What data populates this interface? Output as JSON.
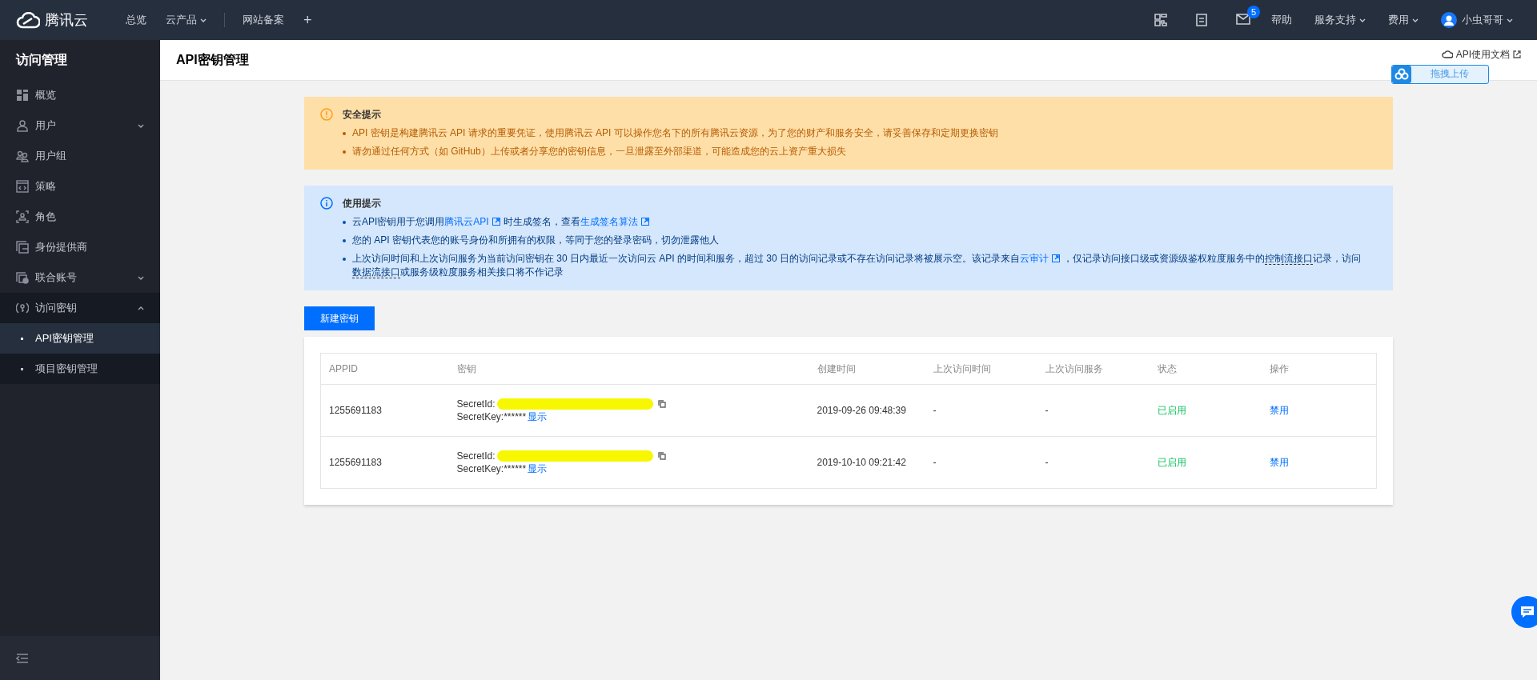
{
  "topbar": {
    "logo": "腾讯云",
    "nav": [
      {
        "label": "总览",
        "dropdown": false
      },
      {
        "label": "云产品",
        "dropdown": true
      },
      {
        "label": "网站备案",
        "dropdown": false
      }
    ],
    "plus": "+",
    "mail_badge": "5",
    "right": [
      {
        "label": "帮助",
        "dropdown": false
      },
      {
        "label": "服务支持",
        "dropdown": true
      },
      {
        "label": "费用",
        "dropdown": true
      }
    ],
    "user": "小虫哥哥"
  },
  "sidebar": {
    "title": "访问管理",
    "items": [
      {
        "label": "概览",
        "kind": "link",
        "selected": false
      },
      {
        "label": "用户",
        "kind": "group",
        "expanded": false,
        "selected": false
      },
      {
        "label": "用户组",
        "kind": "link",
        "selected": false
      },
      {
        "label": "策略",
        "kind": "link",
        "selected": false
      },
      {
        "label": "角色",
        "kind": "link",
        "selected": false
      },
      {
        "label": "身份提供商",
        "kind": "link",
        "selected": false
      },
      {
        "label": "联合账号",
        "kind": "group",
        "expanded": false,
        "selected": false
      },
      {
        "label": "访问密钥",
        "kind": "group",
        "expanded": true,
        "selected": false,
        "children": [
          {
            "label": "API密钥管理",
            "selected": true
          },
          {
            "label": "项目密钥管理",
            "selected": false
          }
        ]
      }
    ]
  },
  "header": {
    "title": "API密钥管理",
    "doc_link": "API使用文档",
    "upload_widget": "拖拽上传"
  },
  "alerts": [
    {
      "kind": "warning",
      "title": "安全提示",
      "bullets": [
        [
          {
            "kind": "text",
            "text": "API 密钥是构建腾讯云 API 请求的重要凭证，使用腾讯云 API 可以操作您名下的所有腾讯云资源，为了您的财产和服务安全，请妥善保存和定期更换密钥"
          }
        ],
        [
          {
            "kind": "text",
            "text": "请勿通过任何方式（如 GitHub）上传或者分享您的密钥信息，一旦泄露至外部渠道，可能造成您的云上资产重大损失"
          }
        ]
      ]
    },
    {
      "kind": "info",
      "title": "使用提示",
      "bullets": [
        [
          {
            "kind": "text",
            "text": "云API密钥用于您调用"
          },
          {
            "kind": "link",
            "text": "腾讯云API"
          },
          {
            "kind": "text",
            "text": "时生成签名，查看"
          },
          {
            "kind": "link",
            "text": "生成签名算法"
          }
        ],
        [
          {
            "kind": "text",
            "text": "您的 API 密钥代表您的账号身份和所拥有的权限，等同于您的登录密码，切勿泄露他人"
          }
        ],
        [
          {
            "kind": "text",
            "text": "上次访问时间和上次访问服务为当前访问密钥在 30 日内最近一次访问云 API 的时间和服务，超过 30 日的访问记录或不存在访问记录将被展示空。该记录来自"
          },
          {
            "kind": "link",
            "text": "云审计"
          },
          {
            "kind": "text",
            "text": "，仅记录访问接口级或资源级鉴权粒度服务中的"
          },
          {
            "kind": "dashed",
            "text": "控制流接口"
          },
          {
            "kind": "text",
            "text": "记录，访问"
          },
          {
            "kind": "dashed",
            "text": "数据流接口"
          },
          {
            "kind": "text",
            "text": "或服务级粒度服务相关接口将不作记录"
          }
        ]
      ]
    }
  ],
  "create_button": "新建密钥",
  "table": {
    "columns": [
      "APPID",
      "密钥",
      "创建时间",
      "上次访问时间",
      "上次访问服务",
      "状态",
      "操作"
    ],
    "rows": [
      {
        "appid": "1255691183",
        "secret_id_label": "SecretId:",
        "secret_key": "SecretKey:******",
        "show": "显示",
        "created": "2019-09-26 09:48:39",
        "last_time": "-",
        "last_service": "-",
        "status": "已启用",
        "action": "禁用"
      },
      {
        "appid": "1255691183",
        "secret_id_label": "SecretId:",
        "secret_key": "SecretKey:******",
        "show": "显示",
        "created": "2019-10-10 09:21:42",
        "last_time": "-",
        "last_service": "-",
        "status": "已启用",
        "action": "禁用"
      }
    ]
  }
}
